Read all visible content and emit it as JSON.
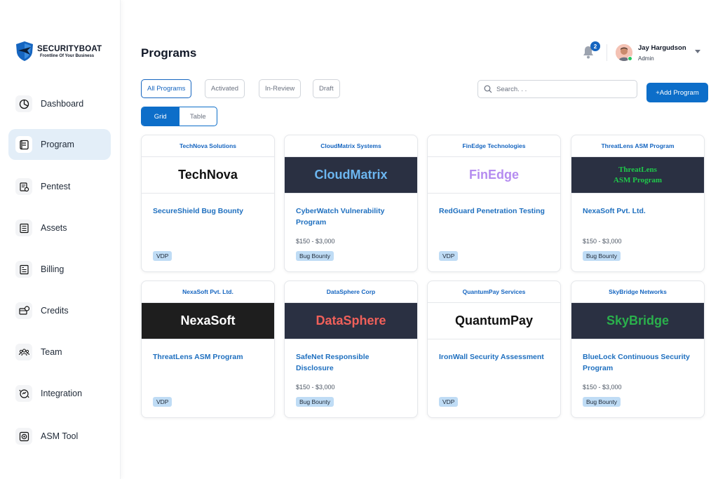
{
  "brand": {
    "name": "SECURITYBOAT",
    "tagline": "Frontline Of Your Business"
  },
  "sidebar": {
    "items": [
      {
        "label": "Dashboard",
        "icon": "pie-chart-icon"
      },
      {
        "label": "Program",
        "icon": "document-icon",
        "active": true
      },
      {
        "label": "Pentest",
        "icon": "pentest-icon"
      },
      {
        "label": "Assets",
        "icon": "list-icon"
      },
      {
        "label": "Billing",
        "icon": "receipt-icon"
      },
      {
        "label": "Credits",
        "icon": "credits-icon"
      },
      {
        "label": "Team",
        "icon": "team-icon"
      },
      {
        "label": "Integration",
        "icon": "integration-icon"
      },
      {
        "label": "ASM Tool",
        "icon": "asm-tool-icon"
      }
    ]
  },
  "header": {
    "title": "Programs",
    "notifications": "2",
    "user": {
      "name": "Jay Hargudson",
      "role": "Admin"
    }
  },
  "filters": {
    "tabs": [
      "All Programs",
      "Activated",
      "In-Review",
      "Draft"
    ],
    "active": "All Programs",
    "search_placeholder": "Search. . .",
    "add_label": "+Add Program",
    "views": [
      "Grid",
      "Table"
    ]
  },
  "colors": {
    "accent": "#0d6ec9",
    "link": "#1e6fbf",
    "badge": "#bfdcf5"
  },
  "cards": [
    {
      "company": "TechNova Solutions",
      "banner": "TechNova",
      "banner_bg": "#ffffff",
      "banner_fg": "#111111",
      "title": "SecureShield Bug Bounty",
      "price": "",
      "badge": "VDP"
    },
    {
      "company": "CloudMatrix Systems",
      "banner": "CloudMatrix",
      "banner_bg": "#2a3042",
      "banner_fg": "#6cb6f0",
      "title": "CyberWatch Vulnerability Program",
      "price": "$150 - $3,000",
      "badge": "Bug Bounty"
    },
    {
      "company": "FinEdge Technologies",
      "banner": "FinEdge",
      "banner_bg": "#ffffff",
      "banner_fg": "#b58cf0",
      "title": "RedGuard Penetration Testing",
      "price": "",
      "badge": "VDP"
    },
    {
      "company": "ThreatLens ASM Program",
      "banner": "ThreatLens\nASM Program",
      "banner_bg": "#2a3042",
      "banner_fg": "#1fc84a",
      "serif": true,
      "title": "NexaSoft Pvt. Ltd.",
      "price": "$150 - $3,000",
      "badge": "Bug Bounty"
    },
    {
      "company": "NexaSoft Pvt. Ltd.",
      "banner": "NexaSoft",
      "banner_bg": "#1e1e1e",
      "banner_fg": "#ffffff",
      "title": "ThreatLens ASM Program",
      "price": "",
      "badge": "VDP"
    },
    {
      "company": "DataSphere Corp",
      "banner": "DataSphere",
      "banner_bg": "#2a3042",
      "banner_fg": "#f0605a",
      "title": "SafeNet Responsible Disclosure",
      "price": "$150 - $3,000",
      "badge": "Bug Bounty"
    },
    {
      "company": "QuantumPay Services",
      "banner": "QuantumPay",
      "banner_bg": "#ffffff",
      "banner_fg": "#111111",
      "title": "IronWall Security Assessment",
      "price": "",
      "badge": "VDP"
    },
    {
      "company": "SkyBridge Networks",
      "banner": "SkyBridge",
      "banner_bg": "#2a3042",
      "banner_fg": "#2ab04c",
      "title": "BlueLock Continuous Security Program",
      "price": "$150 - $3,000",
      "badge": "Bug Bounty"
    }
  ]
}
